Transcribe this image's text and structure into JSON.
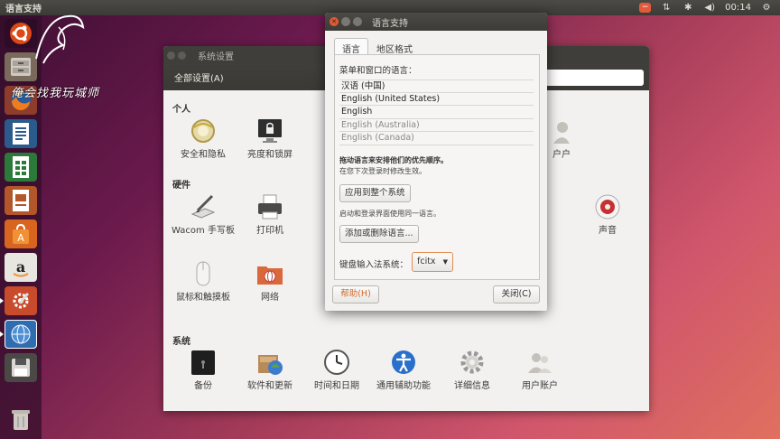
{
  "top_panel": {
    "app_title": "语言支持",
    "clock": "00:14"
  },
  "launcher": {
    "items": [
      {
        "name": "dash"
      },
      {
        "name": "files"
      },
      {
        "name": "firefox"
      },
      {
        "name": "writer"
      },
      {
        "name": "calc"
      },
      {
        "name": "impress"
      },
      {
        "name": "software-center"
      },
      {
        "name": "amazon"
      },
      {
        "name": "system-settings"
      },
      {
        "name": "language-support"
      },
      {
        "name": "save-drive"
      },
      {
        "name": "trash"
      }
    ]
  },
  "watermark": "俺会找我玩城师",
  "settings": {
    "title": "系统设置",
    "toolbar_label": "全部设置(A)",
    "sections": {
      "personal": "个人",
      "hardware": "硬件",
      "system": "系统"
    },
    "personal_items": [
      "安全和隐私",
      "亮度和锁屏"
    ],
    "personal_right_item": "户户",
    "hardware_items": [
      "Wacom 手写板",
      "打印机"
    ],
    "hardware_items_row2": [
      "鼠标和触摸板",
      "网络"
    ],
    "hardware_right_item": "声音",
    "system_items": [
      "备份",
      "软件和更新",
      "时间和日期",
      "通用辅助功能",
      "详细信息",
      "用户账户"
    ]
  },
  "language_dialog": {
    "title": "语言支持",
    "tabs": [
      "语言",
      "地区格式"
    ],
    "menu_label": "菜单和窗口的语言：",
    "languages": [
      {
        "label": "汉语 (中国)",
        "enabled": true
      },
      {
        "label": "English (United States)",
        "enabled": true
      },
      {
        "label": "English",
        "enabled": true
      },
      {
        "label": "English (Australia)",
        "enabled": false
      },
      {
        "label": "English (Canada)",
        "enabled": false
      }
    ],
    "drag_hint": "拖动语言来安排他们的优先顺序。",
    "effect_hint": "在您下次登录时修改生效。",
    "apply_button": "应用到整个系统",
    "apply_hint": "启动和登录界面使用同一语言。",
    "install_button": "添加或删除语言...",
    "im_label": "键盘输入法系统：",
    "im_value": "fcitx",
    "help_button": "帮助(H)",
    "close_button": "关闭(C)"
  },
  "colors": {
    "accent_orange": "#e05b35",
    "panel_dark": "#3c3b37"
  }
}
